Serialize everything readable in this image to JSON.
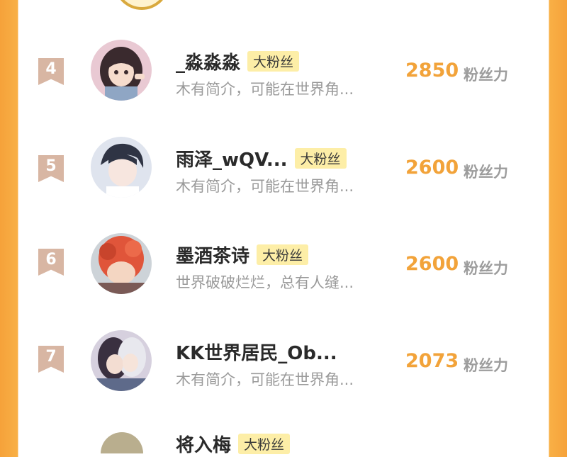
{
  "colors": {
    "accent": "#f2a33a",
    "badge_bg": "#fdeea7",
    "rank_bg": "#d8b6a3",
    "border_orange": "#f6a23a"
  },
  "rows": [
    {
      "rank": "4",
      "name": "_淼淼淼",
      "badge": "大粉丝",
      "desc": "木有简介，可能在世界角...",
      "score": "2850",
      "unit": "粉丝力"
    },
    {
      "rank": "5",
      "name": "雨泽_wQV...",
      "badge": "大粉丝",
      "desc": "木有简介，可能在世界角...",
      "score": "2600",
      "unit": "粉丝力"
    },
    {
      "rank": "6",
      "name": "墨酒茶诗",
      "badge": "大粉丝",
      "desc": "世界破破烂烂，总有人缝...",
      "score": "2600",
      "unit": "粉丝力"
    },
    {
      "rank": "7",
      "name": "KK世界居民_Ob...",
      "badge": "",
      "desc": "木有简介，可能在世界角...",
      "score": "2073",
      "unit": "粉丝力"
    }
  ],
  "partial_row": {
    "name": "将入梅",
    "badge": "大粉丝"
  }
}
